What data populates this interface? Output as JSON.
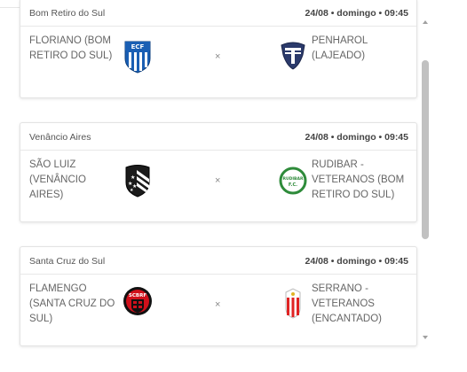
{
  "matches": [
    {
      "city": "Bom Retiro do Sul",
      "when": "24/08 • domingo • 09:45",
      "home": "FLORIANO (BOM RETIRO DO SUL)",
      "away": "PENHAROL (LAJEADO)",
      "home_logo": "ecf-shield",
      "away_logo": "penharol-shield",
      "home_logo_text": "ECF"
    },
    {
      "city": "Venâncio Aires",
      "when": "24/08 • domingo • 09:45",
      "home": "SÃO LUIZ (VENÂNCIO AIRES)",
      "away": "RUDIBAR - VETERANOS (BOM RETIRO DO SUL)",
      "home_logo": "sao-luiz-shield",
      "away_logo": "rudibar-crest",
      "away_logo_text": "RUDIBAR F.C."
    },
    {
      "city": "Santa Cruz do Sul",
      "when": "24/08 • domingo • 09:45",
      "home": "FLAMENGO (SANTA CRUZ DO SUL)",
      "away": "SERRANO - VETERANOS (ENCANTADO)",
      "home_logo": "scbrf-crest",
      "away_logo": "serrano-shield",
      "home_logo_text": "SCBRF"
    }
  ],
  "vs_symbol": "×",
  "colors": {
    "ecf_blue": "#1a5fb4",
    "penharol_navy": "#2b3a6b",
    "rudibar_green": "#2e8b3a",
    "flamengo_red": "#d0101b",
    "serrano_red": "#e02424"
  }
}
